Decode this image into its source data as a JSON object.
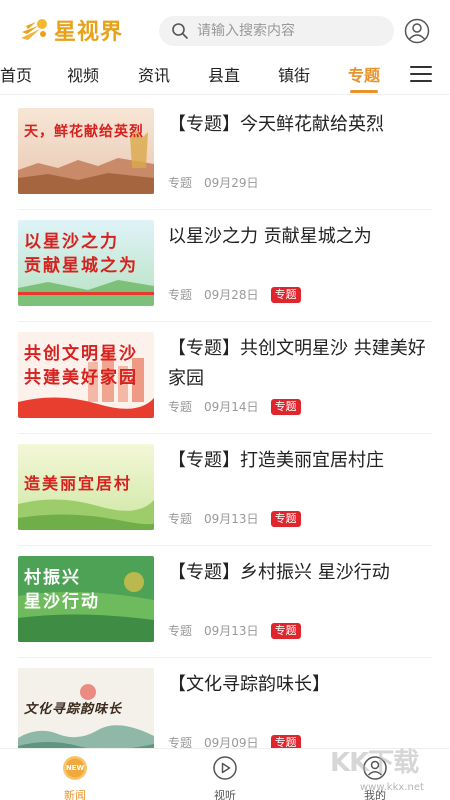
{
  "header": {
    "logo_text": "星视界",
    "search_placeholder": "请输入搜索内容"
  },
  "tabs": [
    {
      "label": "首页",
      "active": false
    },
    {
      "label": "视频",
      "active": false
    },
    {
      "label": "资讯",
      "active": false
    },
    {
      "label": "县直",
      "active": false
    },
    {
      "label": "镇街",
      "active": false
    },
    {
      "label": "专题",
      "active": true
    }
  ],
  "items": [
    {
      "title": "【专题】今天鲜花献给英烈",
      "source": "专题",
      "date": "09月29日",
      "badge": "",
      "thumb_text": "天，鲜花献给英烈"
    },
    {
      "title": "以星沙之力 贡献星城之为",
      "source": "专题",
      "date": "09月28日",
      "badge": "专题",
      "thumb_text": "以星沙之力\n贡献星城之为"
    },
    {
      "title": "【专题】共创文明星沙 共建美好家园",
      "source": "专题",
      "date": "09月14日",
      "badge": "专题",
      "thumb_text": "共创文明星沙\n共建美好家园"
    },
    {
      "title": "【专题】打造美丽宜居村庄",
      "source": "专题",
      "date": "09月13日",
      "badge": "专题",
      "thumb_text": "造美丽宜居村"
    },
    {
      "title": "【专题】乡村振兴 星沙行动",
      "source": "专题",
      "date": "09月13日",
      "badge": "专题",
      "thumb_text": "村振兴\n星沙行动"
    },
    {
      "title": "【文化寻踪韵味长】",
      "source": "专题",
      "date": "09月09日",
      "badge": "专题",
      "thumb_text": "文化寻踪韵味长"
    }
  ],
  "bottom_nav": [
    {
      "label": "新闻",
      "active": true,
      "icon": "new-badge-icon",
      "icon_text": "NEW"
    },
    {
      "label": "视听",
      "active": false,
      "icon": "play-circle-icon"
    },
    {
      "label": "我的",
      "active": false,
      "icon": "person-icon"
    }
  ],
  "watermark": {
    "text": "KK下载",
    "url": "www.kkx.net"
  },
  "colors": {
    "accent": "#e8932a",
    "badge": "#e0262d",
    "logo": "#e8a21a"
  }
}
